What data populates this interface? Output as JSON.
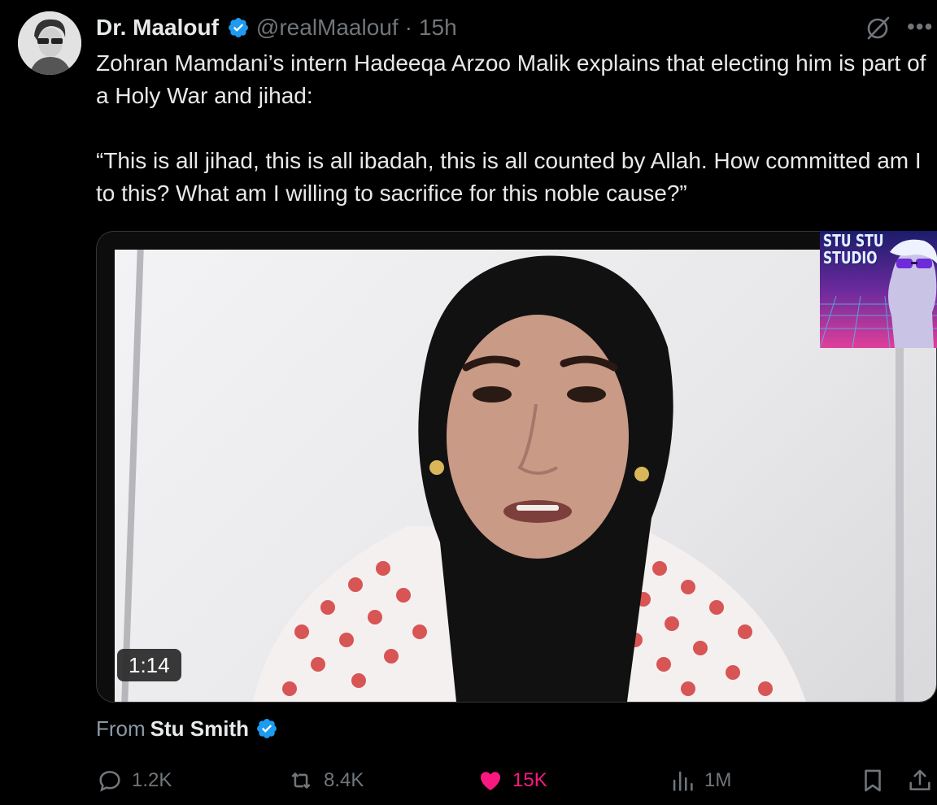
{
  "author": {
    "name": "Dr. Maalouf",
    "handle": "@realMaalouf",
    "separator": "·",
    "time": "15h"
  },
  "tweet": {
    "text": "Zohran Mamdani’s intern Hadeeqa Arzoo Malik explains that electing him is part of a Holy War and jihad:\n\n“This is all jihad, this is all ibadah, this is all counted by Allah. How committed am I to this? What am I willing to sacrifice for this noble cause?”"
  },
  "media": {
    "duration": "1:14",
    "overlay_text": "STU STU\nSTUDIO"
  },
  "source": {
    "label": "From",
    "name": "Stu Smith"
  },
  "actions": {
    "replies": "1.2K",
    "reposts": "8.4K",
    "likes": "15K",
    "views": "1M"
  },
  "icons": {
    "verified": "verified-badge-icon",
    "grok": "grok-icon",
    "more": "more-icon",
    "reply": "reply-icon",
    "repost": "repost-icon",
    "like": "heart-icon",
    "views": "views-icon",
    "bookmark": "bookmark-icon",
    "share": "share-icon"
  },
  "colors": {
    "background": "#000000",
    "text": "#e7e9ea",
    "muted": "#71767b",
    "verified": "#1d9bf0",
    "like": "#f91880"
  }
}
